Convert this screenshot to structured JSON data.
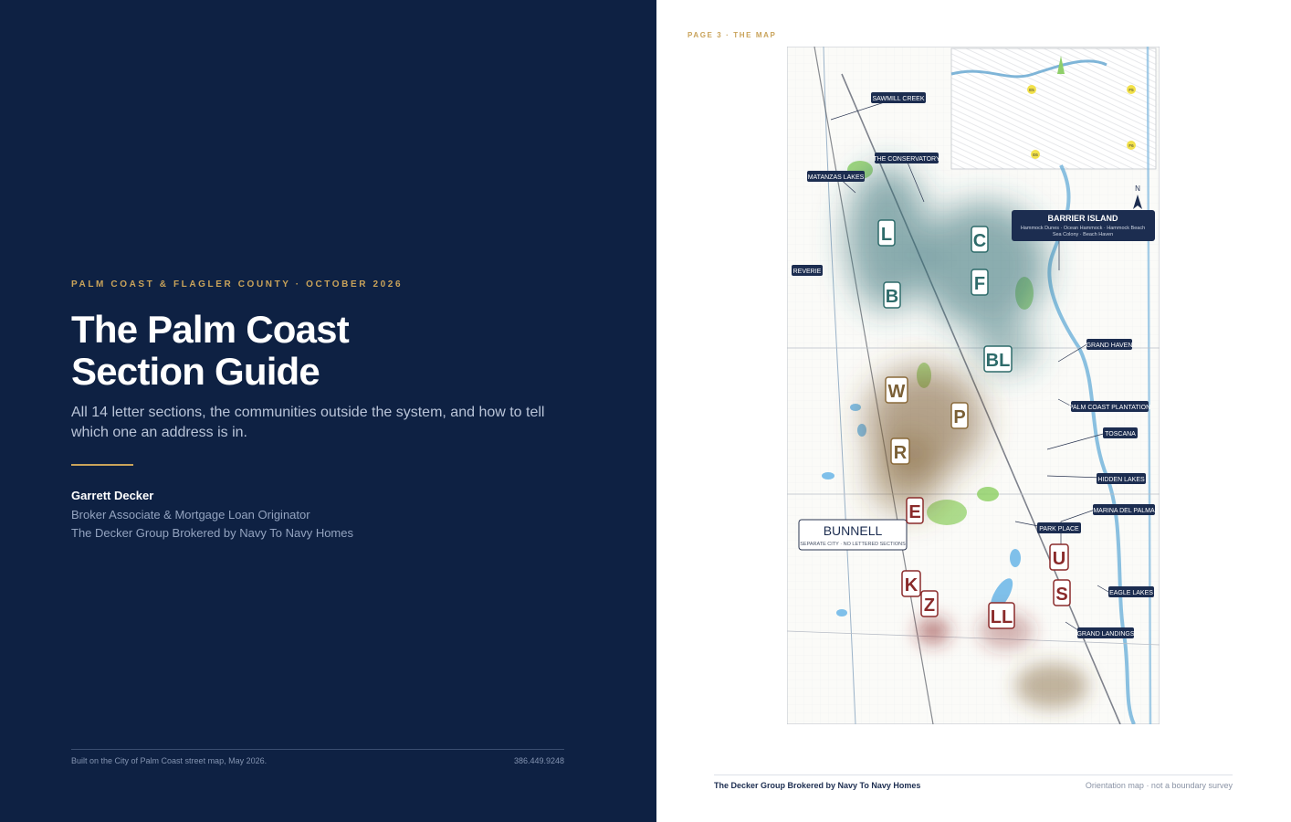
{
  "cover": {
    "eyebrow": "PALM COAST & FLAGLER COUNTY · OCTOBER 2026",
    "title_line1": "The Palm Coast",
    "title_line2": "Section Guide",
    "lede": "All 14 letter sections, the communities outside the system, and how to tell which one an address is in.",
    "author_name": "Garrett Decker",
    "author_role": "Broker Associate & Mortgage Loan Originator",
    "author_firm": "The Decker Group Brokered by Navy To Navy Homes",
    "footer_note": "Built on the City of Palm Coast street map, May 2026.",
    "footer_phone": "386.449.9248"
  },
  "map_page": {
    "page_label": "PAGE 3 · THE MAP",
    "footer_left": "The Decker Group Brokered by Navy To Navy Homes",
    "footer_right": "Orientation map · not a boundary survey",
    "compass": "N",
    "bunnell": {
      "title": "BUNNELL",
      "subtitle": "SEPARATE CITY · NO LETTERED SECTIONS"
    },
    "barrier_island": {
      "title": "BARRIER ISLAND",
      "line1": "Hammock Dunes · Ocean Hammock · Hammock Beach",
      "line2": "Sea Colony · Beach Haven"
    },
    "communities": {
      "sawmill_creek": "SAWMILL CREEK",
      "the_conservatory": "THE CONSERVATORY",
      "matanzas_lakes": "MATANZAS LAKES",
      "reverie": "REVERIE",
      "grand_haven": "GRAND HAVEN",
      "palm_coast_plantation": "PALM COAST PLANTATION",
      "toscana": "TOSCANA",
      "hidden_lakes": "HIDDEN LAKES",
      "marina_del_palma": "MARINA DEL PALMA",
      "park_place": "PARK PLACE",
      "eagle_lakes": "EAGLE LAKES",
      "grand_landings": "GRAND LANDINGS"
    },
    "sections": {
      "L": "L",
      "C": "C",
      "B": "B",
      "F": "F",
      "BL": "BL",
      "W": "W",
      "P": "P",
      "R": "R",
      "E": "E",
      "U": "U",
      "K": "K",
      "Z": "Z",
      "S": "S",
      "LL": "LL"
    },
    "inset_markers": {
      "e5": "E5",
      "f5": "F5",
      "e6": "E6",
      "f6": "F6"
    },
    "colors": {
      "navy": "#0e2143",
      "gold": "#c9a35a",
      "teal_section": "#2e6b6a",
      "olive_section": "#7a5f35",
      "red_section": "#8a2a2a"
    }
  }
}
